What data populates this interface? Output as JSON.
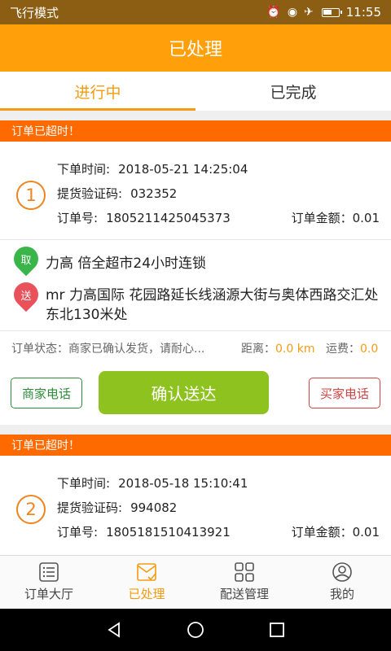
{
  "status_bar": {
    "mode": "飞行模式",
    "time": "11:55",
    "icons": [
      "alarm-icon",
      "eye-icon",
      "airplane-icon",
      "battery-icon"
    ]
  },
  "title": "已处理",
  "tabs": [
    {
      "label": "进行中",
      "active": true
    },
    {
      "label": "已完成",
      "active": false
    }
  ],
  "labels": {
    "timeout": "订单已超时！",
    "order_time": "下单时间:",
    "verify_code": "提货验证码:",
    "order_no": "订单号:",
    "amount": "订单金额：",
    "status_prefix": "订单状态：",
    "distance": "距离：",
    "fee": "运费：",
    "pick_badge": "取",
    "drop_badge": "送",
    "merchant_call": "商家电话",
    "buyer_call": "买家电话",
    "confirm": "确认送达"
  },
  "orders": [
    {
      "index": "1",
      "order_time": "2018-05-21 14:25:04",
      "verify_code": "032352",
      "order_no": "1805211425045373",
      "amount": "0.01",
      "shop": "力高 倍全超市24小时连锁",
      "address": "mr 力高国际 花园路延长线涵源大街与奥体西路交汇处东北130米处",
      "status": "商家已确认发货，请耐心...",
      "distance": "0.0 km",
      "fee": "0.0"
    },
    {
      "index": "2",
      "order_time": "2018-05-18 15:10:41",
      "verify_code": "994082",
      "order_no": "1805181510413921",
      "amount": "0.01"
    }
  ],
  "bottom_nav": [
    {
      "label": "订单大厅",
      "icon": "list-icon",
      "active": false
    },
    {
      "label": "已处理",
      "icon": "mail-check-icon",
      "active": true
    },
    {
      "label": "配送管理",
      "icon": "grid-icon",
      "active": false
    },
    {
      "label": "我的",
      "icon": "user-icon",
      "active": false
    }
  ],
  "colors": {
    "accent": "#ff9f0a",
    "banner": "#ff6a00",
    "confirm": "#8dc21f",
    "merchant": "#2e8b3a",
    "buyer": "#d24343"
  }
}
